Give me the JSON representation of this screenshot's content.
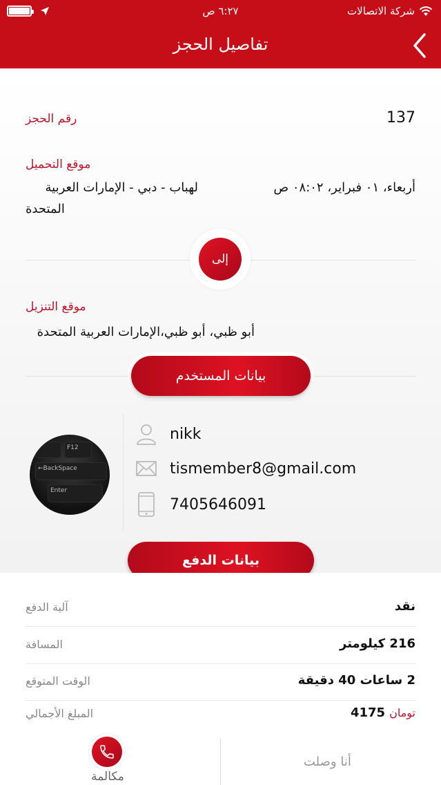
{
  "status_bar": {
    "carrier": "شركة الاتصالات",
    "time": "٦:٢٧ ص"
  },
  "nav": {
    "title": "تفاصيل الحجز"
  },
  "booking": {
    "number_label": "رقم الحجز",
    "number_value": "137",
    "pickup_label": "موقع التحميل",
    "pickup_address_line1": "لهباب - دبي - الإمارات العربية",
    "pickup_address_line2": "المتحدة",
    "pickup_datetime": "أربعاء، ٠١ فبراير، ٠٨:٠٢ ص",
    "to_label": "إلى",
    "dropoff_label": "موقع التنزيل",
    "dropoff_address": "أبو ظبي، أبو ظبي،الإمارات العربية المتحدة"
  },
  "user_section": {
    "title": "بيانات المستخدم",
    "name": "nikk",
    "email": "tismember8@gmail.com",
    "phone": "7405646091",
    "avatar_keys": [
      "F12",
      "←BackSpace",
      "Enter"
    ]
  },
  "payment_section": {
    "title": "بيانات الدفع",
    "rows": [
      {
        "label": "آلية الدفع",
        "value": "نقد"
      },
      {
        "label": "المسافة",
        "value": "216 كيلومتر"
      },
      {
        "label": "الوقت المتوقع",
        "value": "2 ساعات 40 دقيقة"
      },
      {
        "label": "المبلغ الأجمالي",
        "value": "4175",
        "currency": "تومان"
      }
    ]
  },
  "bottom_bar": {
    "call_label": "مكالمة",
    "arrived_label": "أنا وصلت"
  },
  "colors": {
    "brand_red": "#c50e18",
    "label_red": "#c0142a"
  },
  "icons": [
    "back-chevron-icon",
    "wifi-icon",
    "location-arrow-icon",
    "battery-icon",
    "user-icon",
    "mail-icon",
    "phone-icon",
    "call-icon"
  ]
}
